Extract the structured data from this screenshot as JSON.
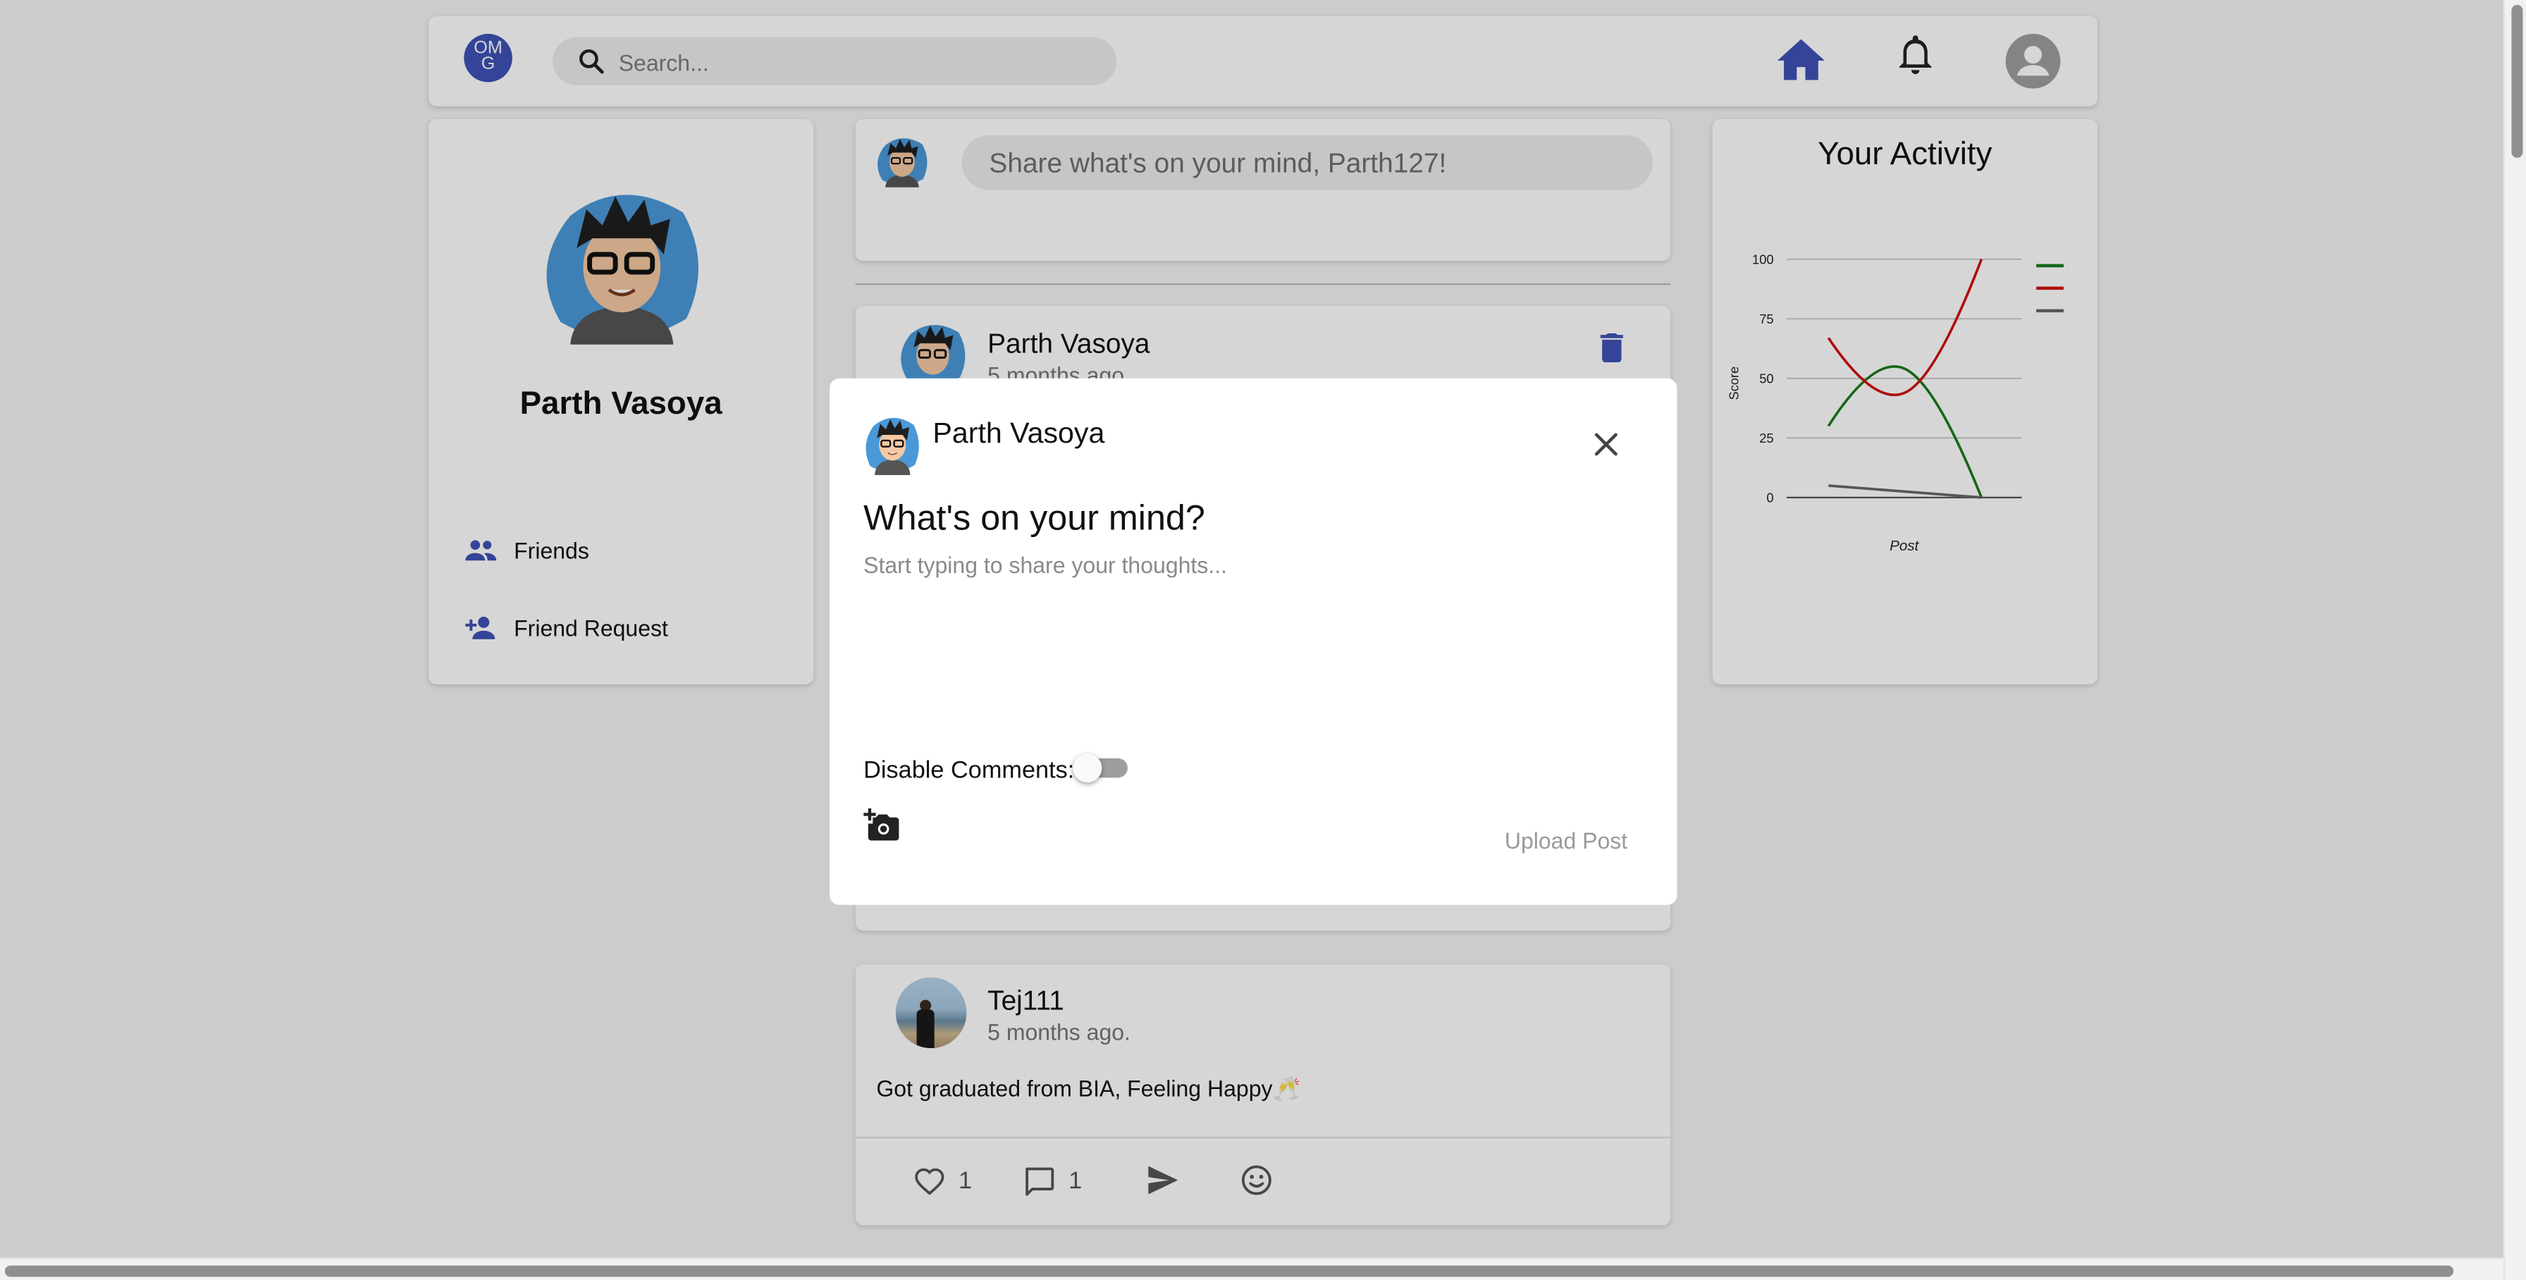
{
  "header": {
    "logo_text": "OMG",
    "search_placeholder": "Search...",
    "accent_color": "#3f51b5"
  },
  "profile": {
    "name": "Parth Vasoya",
    "nav": [
      {
        "label": "Friends",
        "icon": "people-icon"
      },
      {
        "label": "Friend Request",
        "icon": "person-add-icon"
      }
    ]
  },
  "share_box": {
    "placeholder": "Share what's on your mind, Parth127!"
  },
  "feed": [
    {
      "author": "Parth Vasoya",
      "time": "5 months ago."
    },
    {
      "author": "Tej111",
      "time": "5 months ago.",
      "body": "Got graduated from BIA, Feeling Happy🥂",
      "likes": "1",
      "comments": "1"
    }
  ],
  "activity": {
    "title": "Your Activity",
    "chart_data": {
      "type": "line",
      "title": "",
      "xlabel": "Post",
      "ylabel": "Score",
      "ylim": [
        0,
        100
      ],
      "yticks": [
        "0",
        "25",
        "50",
        "75",
        "100"
      ],
      "legend": "right",
      "series": [
        {
          "color": "#1b7a1b",
          "values": [
            30,
            54,
            0
          ]
        },
        {
          "color": "#d01010",
          "values": [
            67,
            44,
            100
          ]
        },
        {
          "color": "#666666",
          "values": [
            5,
            0
          ]
        }
      ]
    }
  },
  "modal": {
    "author": "Parth Vasoya",
    "question": "What's on your mind?",
    "textarea_placeholder": "Start typing to share your thoughts...",
    "disable_comments_label": "Disable Comments:",
    "upload_label": "Upload Post"
  }
}
